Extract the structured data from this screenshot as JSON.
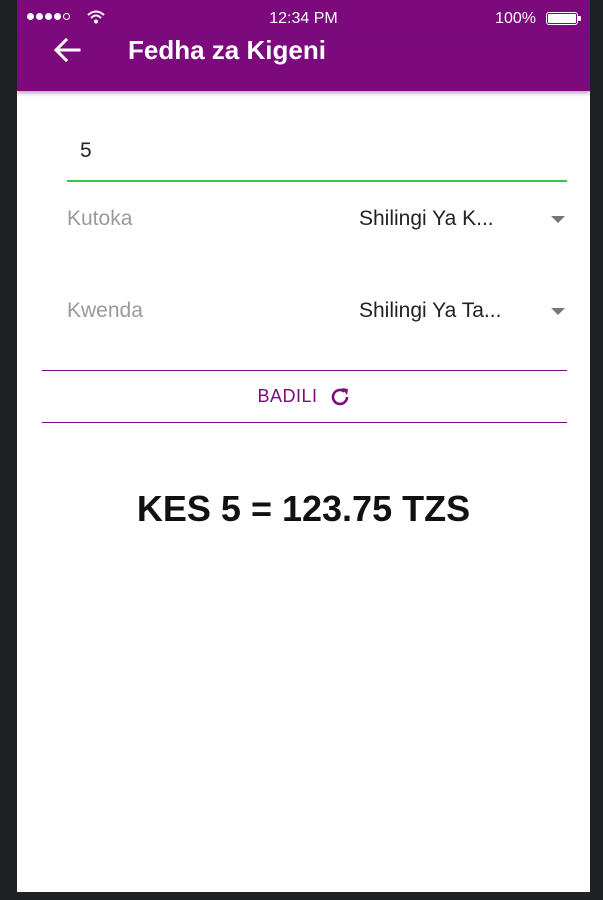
{
  "status_bar": {
    "time": "12:34 PM",
    "battery": "100%"
  },
  "app_bar": {
    "back_icon": "arrow-left-icon",
    "title": "Fedha za Kigeni"
  },
  "amount_field": {
    "value": "5"
  },
  "from": {
    "label": "Kutoka",
    "selected": "Shilingi Ya K..."
  },
  "to": {
    "label": "Kwenda",
    "selected": "Shilingi Ya Ta..."
  },
  "convert_button": {
    "label": "BADILI",
    "icon": "refresh-icon"
  },
  "result": {
    "text": "KES 5 = 123.75 TZS"
  },
  "colors": {
    "primary": "#7d0a7d",
    "input_underline": "#2ecc40"
  }
}
